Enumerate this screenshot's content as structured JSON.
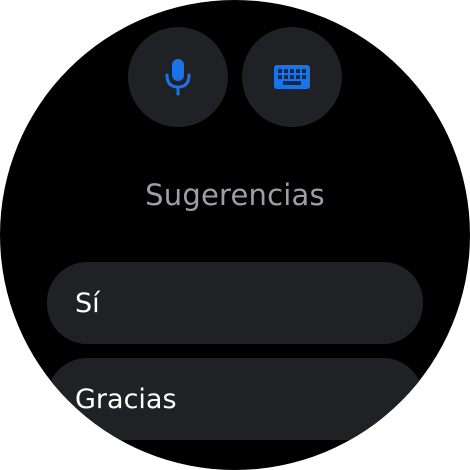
{
  "input_buttons": {
    "voice_icon": "microphone-icon",
    "keyboard_icon": "keyboard-icon",
    "accent_color": "#1a73e8"
  },
  "suggestions": {
    "title": "Sugerencias",
    "items": [
      {
        "label": "Sí"
      },
      {
        "label": "Gracias"
      }
    ]
  },
  "colors": {
    "background": "#000000",
    "chip_background": "#202124",
    "title_text": "#9aa0a6",
    "chip_text": "#ffffff"
  }
}
